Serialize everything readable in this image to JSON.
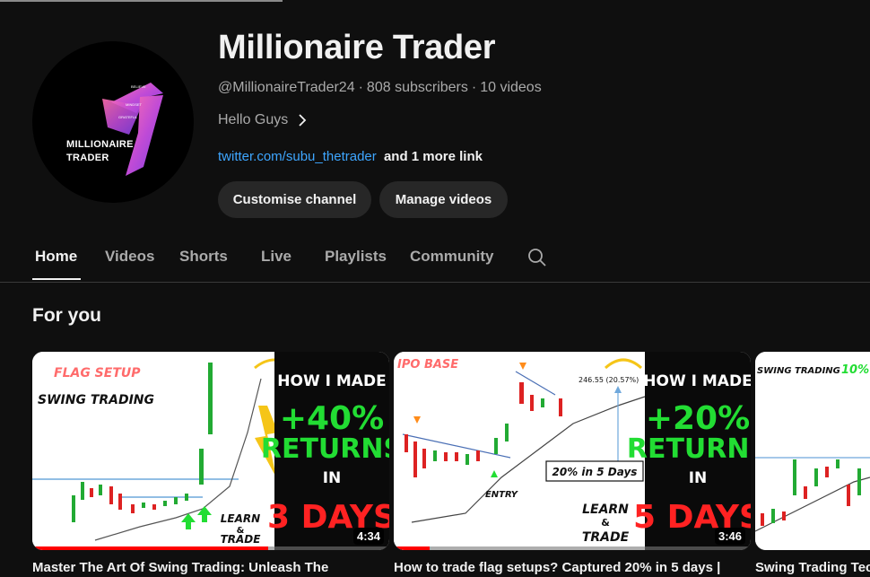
{
  "channel": {
    "name": "Millionaire Trader",
    "handle": "@MillionaireTrader24",
    "subscribers": "808 subscribers",
    "videos": "10 videos",
    "separator": "·",
    "description": "Hello Guys",
    "link_text": "twitter.com/subu_thetrader",
    "more_links": "and 1 more link",
    "avatar": {
      "line1": "MILLIONAIRE",
      "line2": "TRADER",
      "small_words": [
        "BELIEVE",
        "MINDSET",
        "GRATEFUL"
      ]
    }
  },
  "buttons": {
    "customise": "Customise channel",
    "manage": "Manage videos"
  },
  "tabs": [
    "Home",
    "Videos",
    "Shorts",
    "Live",
    "Playlists",
    "Community"
  ],
  "active_tab": "Home",
  "section": {
    "title": "For you"
  },
  "videos": [
    {
      "title": "Master The Art Of Swing Trading: Unleash The",
      "duration": "4:34",
      "watched": 0.66,
      "thumb": {
        "tag": "FLAG SETUP",
        "subtitle": "SWING TRADING",
        "headline": "HOW I MADE",
        "percent": "+40%",
        "returns": "RETURNS",
        "in": "IN",
        "days": "3 DAYS",
        "learn": "LEARN",
        "amp": "&",
        "trade": "TRADE"
      }
    },
    {
      "title": "How to trade flag setups? Captured 20% in 5 days |",
      "duration": "3:46",
      "watched": 0.1,
      "thumb": {
        "tag": "IPO BASE",
        "price_label": "246.55 (20.57%)",
        "callout": "20% in 5 Days",
        "entry": "ENTRY",
        "headline": "HOW I MADE",
        "percent": "+20%",
        "returns": "RETURNS",
        "in": "IN",
        "days": "5 DAYS",
        "learn": "LEARN",
        "amp": "&",
        "trade": "TRADE"
      }
    },
    {
      "title": "Swing Trading Tec",
      "thumb": {
        "subtitle": "SWING TRADING",
        "highlight": "10%"
      }
    }
  ],
  "colors": {
    "background": "#0f0f0f",
    "link": "#3ea6ff",
    "button": "#272727",
    "secondary_text": "#aaaaaa",
    "progress": "#ff0000",
    "thumb_green": "#22dd33",
    "thumb_red": "#ff2222"
  },
  "icons": [
    "search-icon",
    "chevron-right-icon"
  ]
}
